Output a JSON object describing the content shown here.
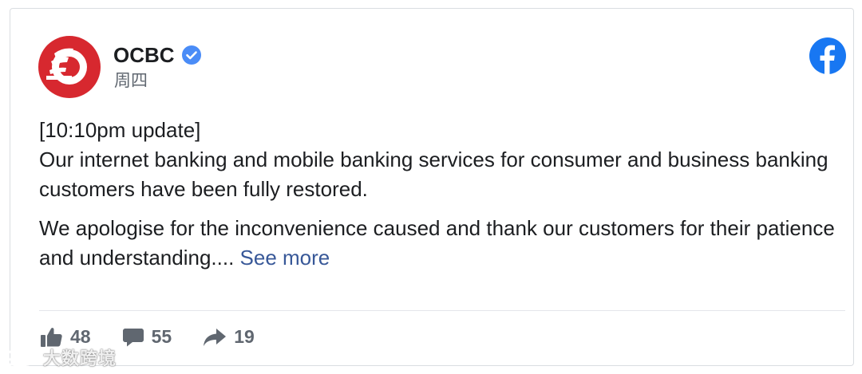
{
  "post": {
    "page_name": "OCBC",
    "timestamp": "周四",
    "paragraphs": [
      "[10:10pm update]",
      "Our internet banking and mobile banking services for consumer and business banking customers have been fully restored.",
      "We apologise for the inconvenience caused and thank our customers for their patience and understanding...."
    ],
    "see_more": "See more"
  },
  "stats": {
    "likes": "48",
    "comments": "55",
    "shares": "19"
  },
  "watermark": "大数跨境",
  "icons": {
    "avatar": "ocbc-logo-icon",
    "verified": "verified-badge-icon",
    "platform": "facebook-icon",
    "like": "thumbs-up-icon",
    "comment": "comment-icon",
    "share": "share-arrow-icon"
  },
  "colors": {
    "brand_red": "#d7282f",
    "facebook_blue": "#1877f2",
    "link": "#385898",
    "text": "#1c1e21",
    "meta": "#606770"
  }
}
